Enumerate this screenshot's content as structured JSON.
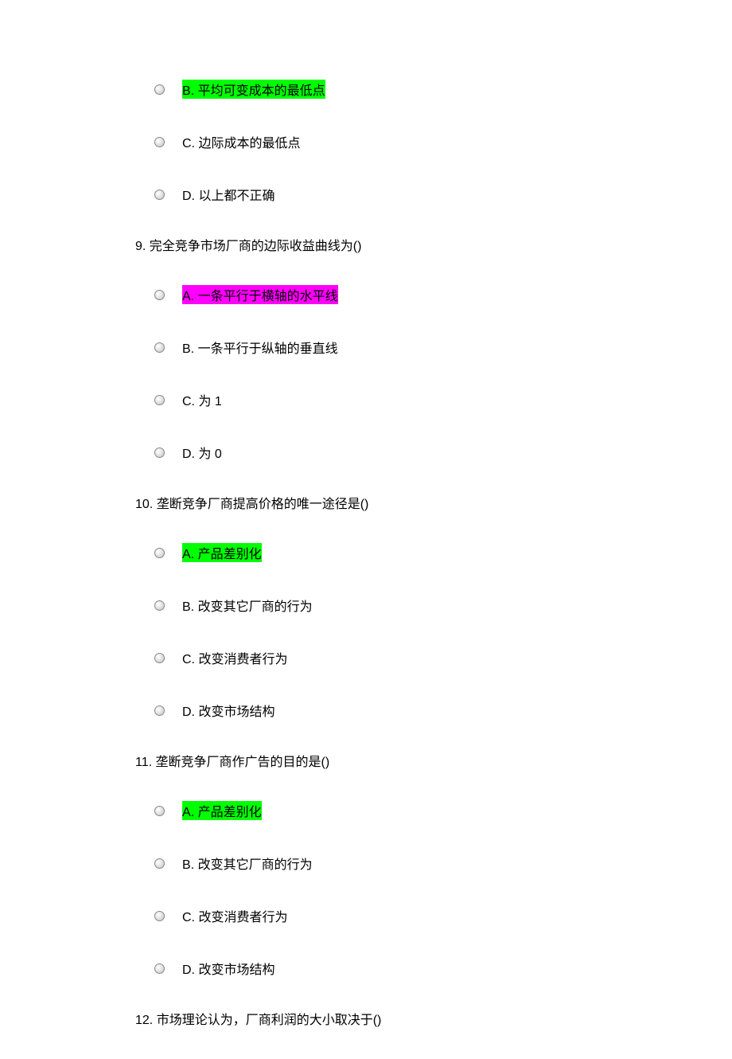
{
  "partial": {
    "options": [
      {
        "letter": "B.",
        "text": "平均可变成本的最低点",
        "highlight": "green"
      },
      {
        "letter": "C.",
        "text": "边际成本的最低点",
        "highlight": null
      },
      {
        "letter": "D.",
        "text": "以上都不正确",
        "highlight": null
      }
    ]
  },
  "questions": [
    {
      "number": "9.",
      "text": "完全竞争市场厂商的边际收益曲线为()",
      "options": [
        {
          "letter": "A.",
          "text": "一条平行于横轴的水平线",
          "highlight": "magenta"
        },
        {
          "letter": "B.",
          "text": "一条平行于纵轴的垂直线",
          "highlight": null
        },
        {
          "letter": "C.",
          "text": "为 1",
          "highlight": null
        },
        {
          "letter": "D.",
          "text": "为 0",
          "highlight": null
        }
      ]
    },
    {
      "number": "10.",
      "text": "垄断竞争厂商提高价格的唯一途径是()",
      "options": [
        {
          "letter": "A.",
          "text": "产品差别化",
          "highlight": "green"
        },
        {
          "letter": "B.",
          "text": "改变其它厂商的行为",
          "highlight": null
        },
        {
          "letter": "C.",
          "text": "改变消费者行为",
          "highlight": null
        },
        {
          "letter": "D.",
          "text": "改变市场结构",
          "highlight": null
        }
      ]
    },
    {
      "number": "11.",
      "text": "垄断竞争厂商作广告的目的是()",
      "options": [
        {
          "letter": "A.",
          "text": "产品差别化",
          "highlight": "green"
        },
        {
          "letter": "B.",
          "text": "改变其它厂商的行为",
          "highlight": null
        },
        {
          "letter": "C.",
          "text": "改变消费者行为",
          "highlight": null
        },
        {
          "letter": "D.",
          "text": "改变市场结构",
          "highlight": null
        }
      ]
    },
    {
      "number": "12.",
      "text": "市场理论认为，厂商利润的大小取决于()",
      "options": []
    }
  ]
}
